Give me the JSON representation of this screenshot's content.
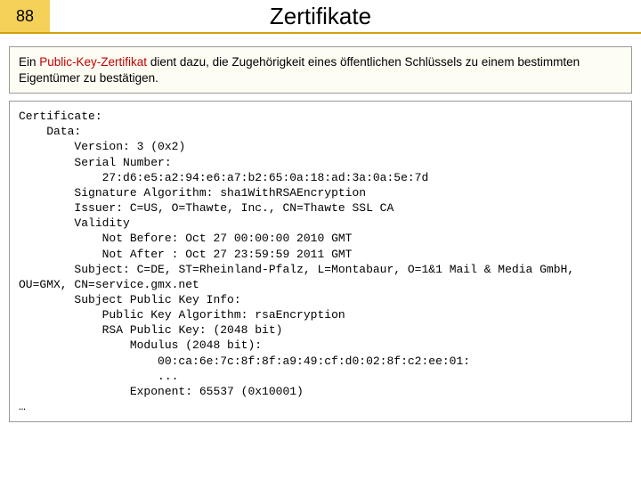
{
  "header": {
    "page_number": "88",
    "title": "Zertifikate"
  },
  "description": {
    "prefix": "Ein ",
    "term": "Public-Key-Zertifikat",
    "rest": " dient dazu, die Zugehörigkeit eines öffentlichen Schlüssels zu einem bestimmten Eigentümer zu bestätigen."
  },
  "certificate": {
    "lines": {
      "l0": "Certificate:",
      "l1": "    Data:",
      "l2": "        Version: 3 (0x2)",
      "l3": "        Serial Number:",
      "l4": "            27:d6:e5:a2:94:e6:a7:b2:65:0a:18:ad:3a:0a:5e:7d",
      "l5": "        Signature Algorithm: sha1WithRSAEncryption",
      "l6": "        Issuer: C=US, O=Thawte, Inc., CN=Thawte SSL CA",
      "l7": "        Validity",
      "l8": "            Not Before: Oct 27 00:00:00 2010 GMT",
      "l9": "            Not After : Oct 27 23:59:59 2011 GMT",
      "l10": "        Subject: C=DE, ST=Rheinland-Pfalz, L=Montabaur, O=1&1 Mail & Media GmbH, OU=GMX, CN=service.gmx.net",
      "l11": "        Subject Public Key Info:",
      "l12": "            Public Key Algorithm: rsaEncryption",
      "l13": "            RSA Public Key: (2048 bit)",
      "l14": "                Modulus (2048 bit):",
      "l15": "                    00:ca:6e:7c:8f:8f:a9:49:cf:d0:02:8f:c2:ee:01:",
      "l16": "                    ...",
      "l17": "                Exponent: 65537 (0x10001)",
      "l18": "…"
    }
  }
}
